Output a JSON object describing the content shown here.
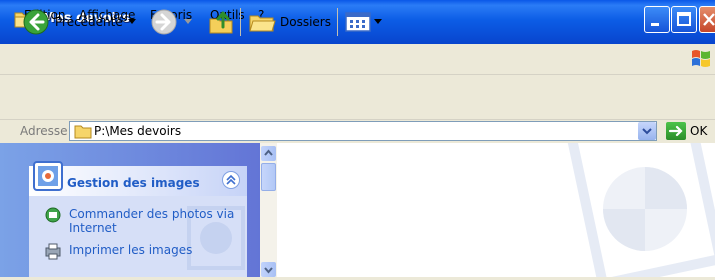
{
  "window": {
    "title": "Mes devoirs"
  },
  "menu": [
    {
      "label": "Edition"
    },
    {
      "label": "Affichage"
    },
    {
      "label": "Favoris"
    },
    {
      "label": "Outils"
    },
    {
      "label": "?"
    }
  ],
  "toolbar": {
    "back_label": "Précédente",
    "folders_label": "Dossiers"
  },
  "address": {
    "label": "Adresse",
    "value": "P:\\Mes devoirs",
    "go_label": "OK"
  },
  "tasks_panel": {
    "title": "Gestion des images",
    "links": [
      {
        "label_line1": "Commander des photos via",
        "label_line2": "Internet"
      },
      {
        "label": "Imprimer les images"
      }
    ]
  },
  "colors": {
    "titlebar": "#0A58E8",
    "panel_link": "#215DC6"
  }
}
